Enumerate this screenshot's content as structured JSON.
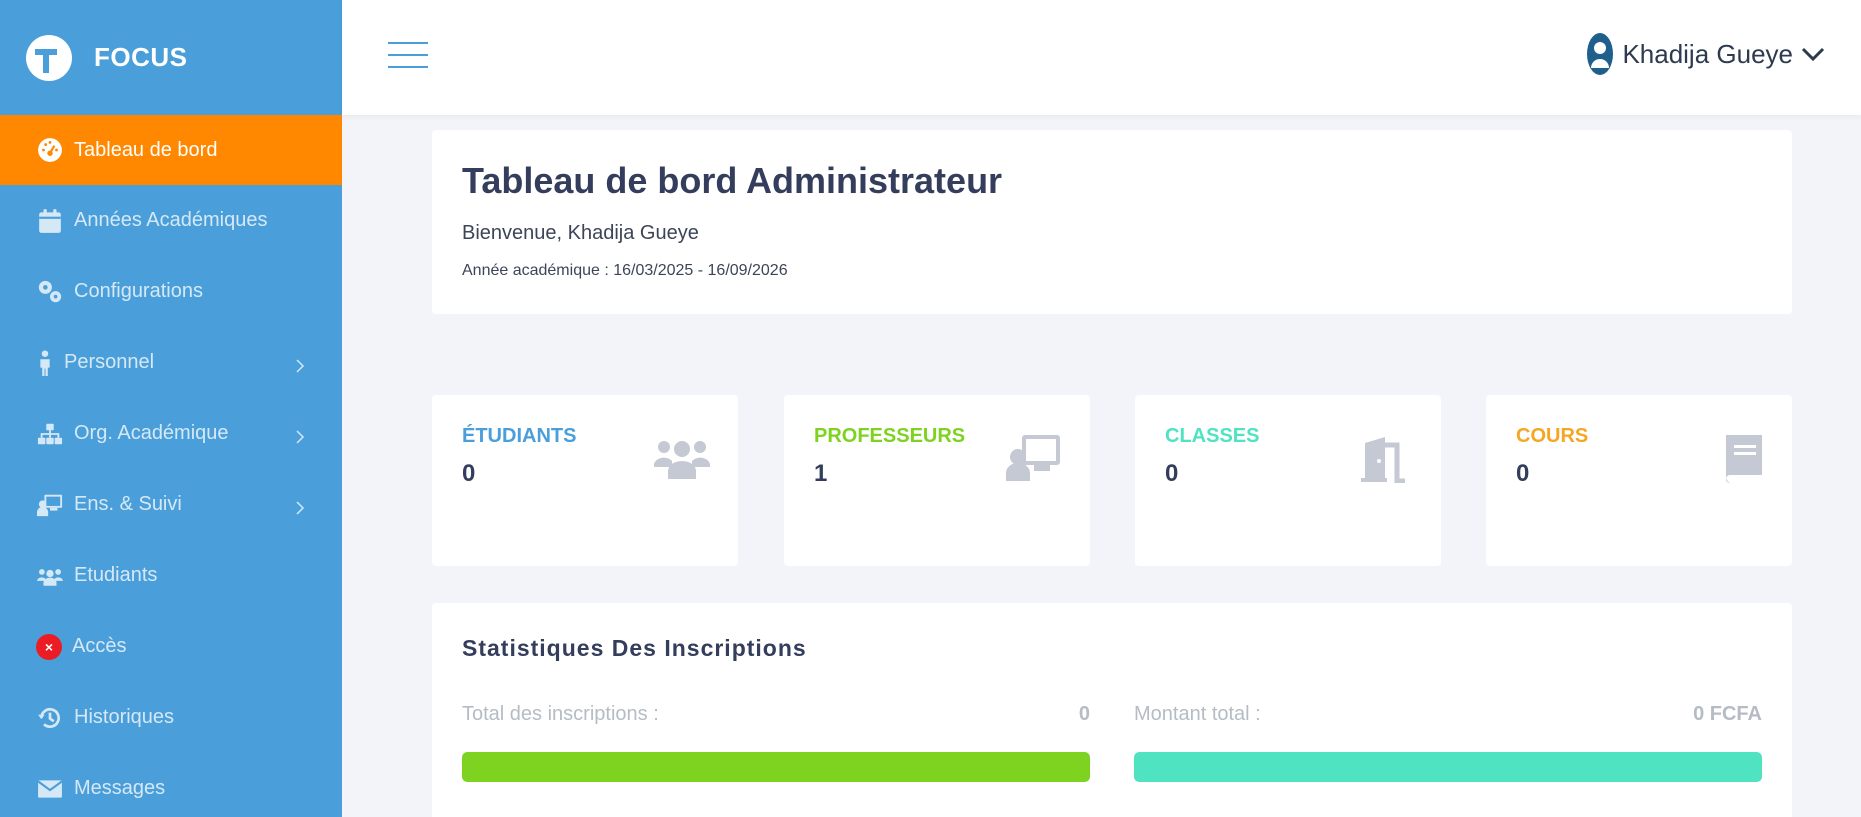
{
  "brand": {
    "name": "FOCUS"
  },
  "sidebar": {
    "items": [
      {
        "label": "Tableau de bord",
        "icon": "dashboard-icon",
        "active": true
      },
      {
        "label": "Années Académiques",
        "icon": "calendar-icon"
      },
      {
        "label": "Configurations",
        "icon": "gears-icon"
      },
      {
        "label": "Personnel",
        "icon": "person-icon",
        "has_children": true
      },
      {
        "label": "Org. Académique",
        "icon": "sitemap-icon",
        "has_children": true
      },
      {
        "label": "Ens. & Suivi",
        "icon": "teacher-icon",
        "has_children": true
      },
      {
        "label": "Etudiants",
        "icon": "users-icon"
      },
      {
        "label": "Accès",
        "icon": "close-circle-icon"
      },
      {
        "label": "Historiques",
        "icon": "history-icon"
      },
      {
        "label": "Messages",
        "icon": "envelope-icon"
      }
    ]
  },
  "topbar": {
    "user_name": "Khadija Gueye"
  },
  "welcome": {
    "title": "Tableau de bord Administrateur",
    "greeting": "Bienvenue, Khadija Gueye",
    "academic_year": "Année académique : 16/03/2025 - 16/09/2026"
  },
  "stats": [
    {
      "label": "ÉTUDIANTS",
      "value": "0",
      "color": "#4a9fda",
      "icon": "users-icon"
    },
    {
      "label": "PROFESSEURS",
      "value": "1",
      "color": "#7ed321",
      "icon": "teacher-icon"
    },
    {
      "label": "CLASSES",
      "value": "0",
      "color": "#50e3c2",
      "icon": "door-icon"
    },
    {
      "label": "COURS",
      "value": "0",
      "color": "#f5a623",
      "icon": "book-icon"
    }
  ],
  "enrollments": {
    "title": "Statistiques Des Inscriptions",
    "total_label": "Total des inscriptions :",
    "total_value": "0",
    "total_bar_color": "#7ed321",
    "total_bar_fill_percent": 100,
    "amount_label": "Montant total :",
    "amount_value": "0 FCFA",
    "amount_bar_color": "#50e3c2",
    "amount_bar_fill_percent": 100
  },
  "colors": {
    "sidebar": "#4a9fda",
    "active": "#ff8800",
    "text_dark": "#343e5c"
  }
}
